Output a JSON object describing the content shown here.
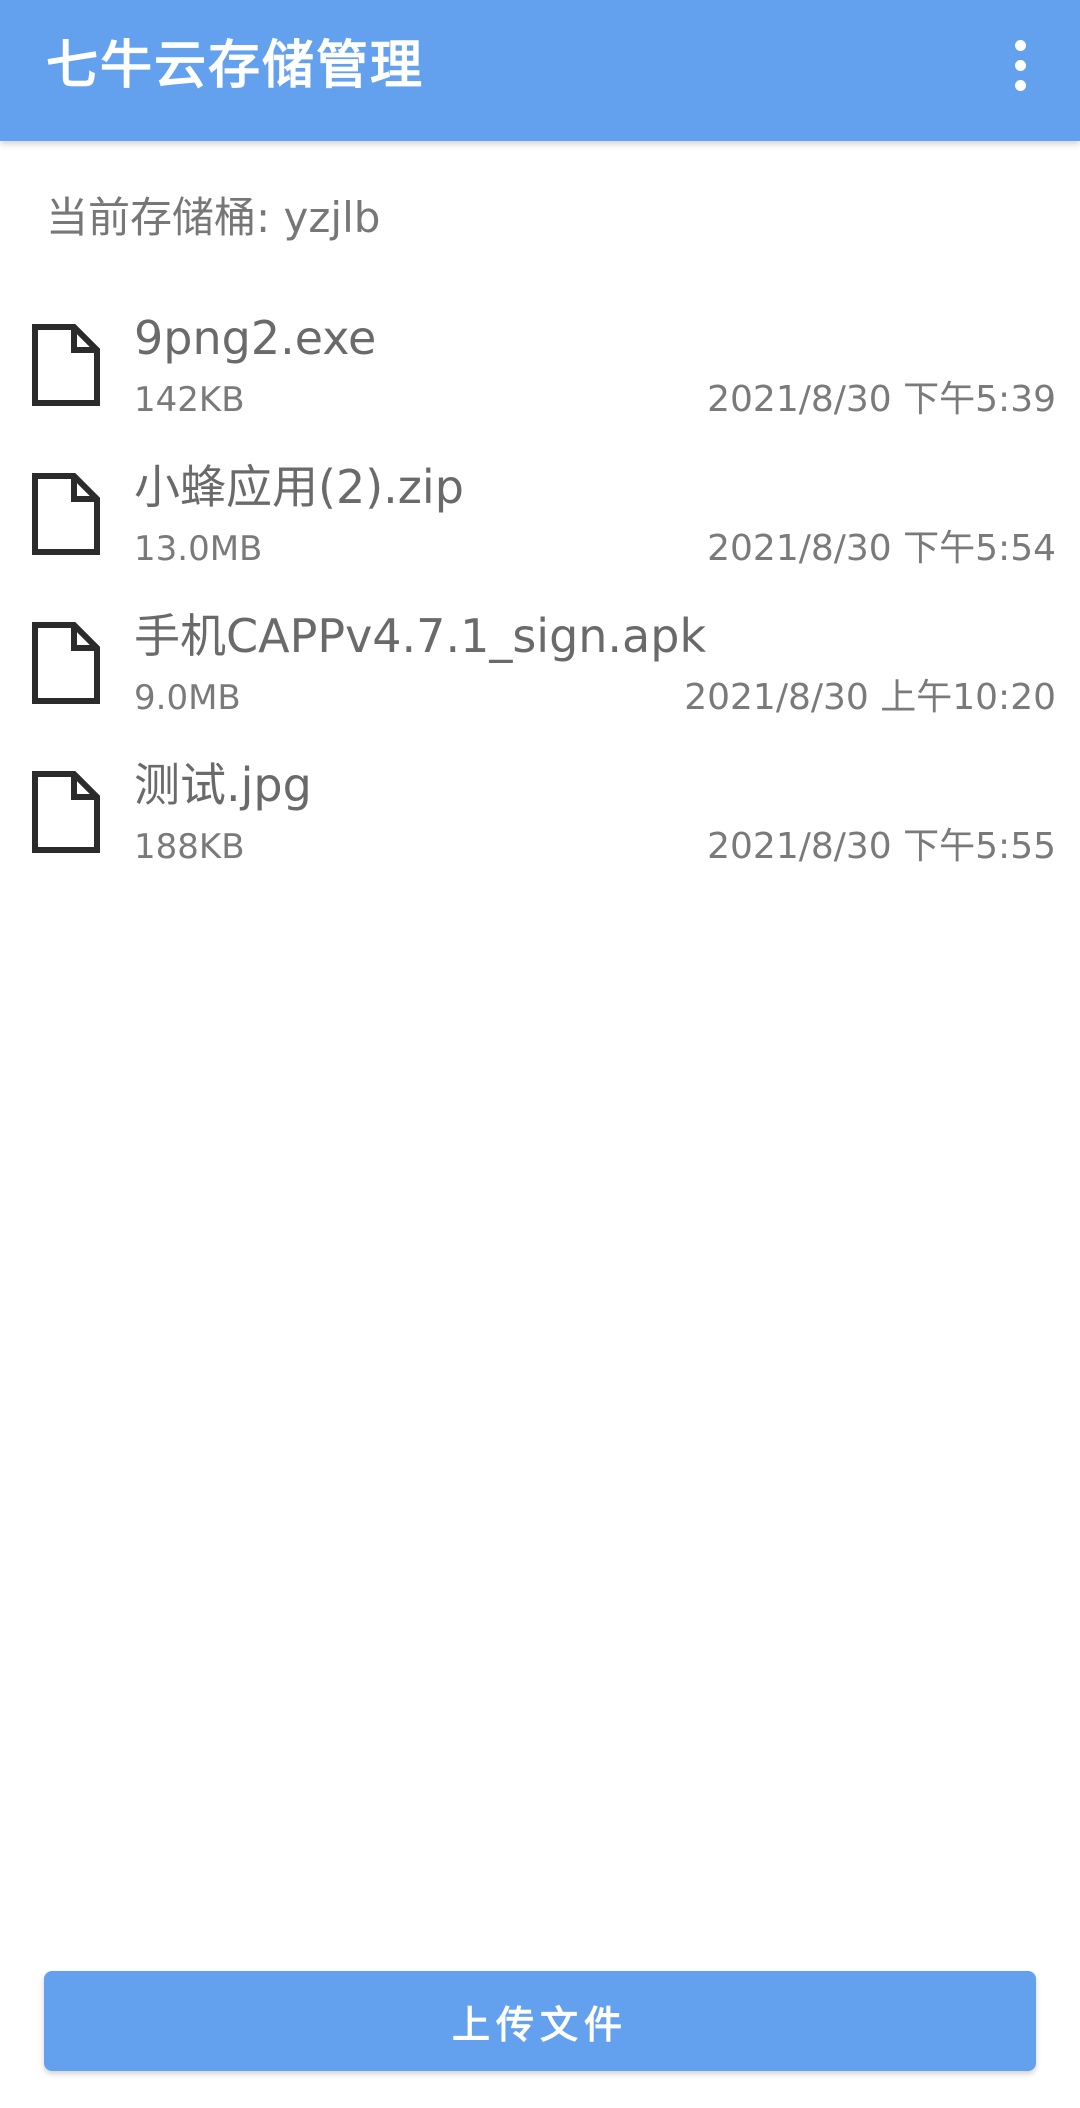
{
  "app_bar": {
    "title": "七牛云存储管理",
    "menu_icon": "more-vert-icon"
  },
  "bucket": {
    "label": "当前存储桶: yzjlb"
  },
  "files": [
    {
      "icon": "file-icon",
      "name": "9png2.exe",
      "size": "142KB",
      "date": "2021/8/30 下午5:39"
    },
    {
      "icon": "file-icon",
      "name": "小蜂应用(2).zip",
      "size": "13.0MB",
      "date": "2021/8/30 下午5:54"
    },
    {
      "icon": "file-icon",
      "name": "手机CAPPv4.7.1_sign.apk",
      "size": "9.0MB",
      "date": "2021/8/30 上午10:20"
    },
    {
      "icon": "file-icon",
      "name": "测试.jpg",
      "size": "188KB",
      "date": "2021/8/30 下午5:55"
    }
  ],
  "upload": {
    "label": "上传文件"
  },
  "colors": {
    "accent": "#63a1ee",
    "text_secondary": "#777777"
  }
}
